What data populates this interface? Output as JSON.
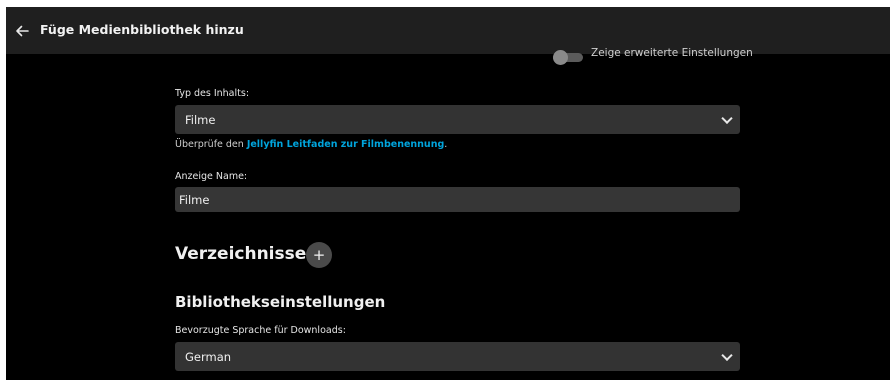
{
  "header": {
    "title": "Füge Medienbibliothek hinzu"
  },
  "advanced_toggle": {
    "label": "Zeige erweiterte Einstellungen",
    "checked": false
  },
  "content_type": {
    "label": "Typ des Inhalts:",
    "value": "Filme"
  },
  "helper": {
    "prefix": "Überprüfe den ",
    "link": "Jellyfin Leitfaden zur Filmbenennung",
    "suffix": "."
  },
  "display_name": {
    "label": "Anzeige Name:",
    "value": "Filme"
  },
  "folders": {
    "title": "Verzeichnisse",
    "add_symbol": "+"
  },
  "library_settings": {
    "title": "Bibliothekseinstellungen"
  },
  "language": {
    "label": "Bevorzugte Sprache für Downloads:",
    "value": "German"
  },
  "colors": {
    "accent": "#00a4dc",
    "header_bg": "#1f1f1f",
    "page_bg": "#000000",
    "field_bg": "#333333"
  },
  "icons": {
    "back": "arrow-left-icon",
    "dropdown": "chevron-down-icon",
    "add": "plus-icon"
  }
}
